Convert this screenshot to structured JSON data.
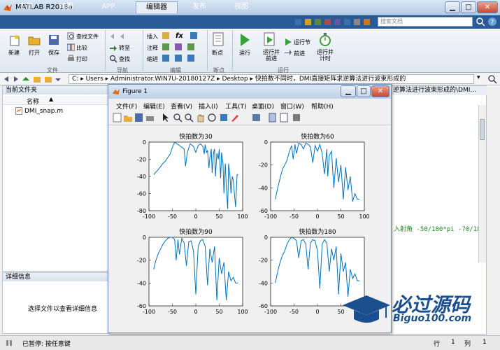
{
  "window": {
    "title": "MATLAB R2018a"
  },
  "tabs": [
    {
      "label": "主页"
    },
    {
      "label": "绘图"
    },
    {
      "label": "APP"
    },
    {
      "label": "编辑器"
    },
    {
      "label": "发布"
    },
    {
      "label": "视图"
    }
  ],
  "search": {
    "placeholder": "搜索文档"
  },
  "ribbon": {
    "file": {
      "new": "新建",
      "open": "打开",
      "save": "保存",
      "find_files": "查找文件",
      "compare": "比较",
      "print": "打印",
      "group": "文件"
    },
    "nav": {
      "goto": "转至",
      "find": "查找",
      "group": "导航"
    },
    "edit": {
      "insert": "插入",
      "comment": "注释",
      "indent": "缩进",
      "fx": "fx",
      "group": "编辑"
    },
    "breakpoints": {
      "breakpoint": "断点",
      "group": "断点"
    },
    "run": {
      "run": "运行",
      "run_advance": "运行并前进",
      "run_section": "运行节",
      "advance": "前进",
      "run_time": "运行并计时",
      "group": "运行"
    }
  },
  "address": {
    "segments": [
      "C:",
      "Users",
      "Administrator.WIN7U-20180127Z",
      "Desktop",
      "快拍数不同时，DMI直接矩阵求逆算法进行波束形成的"
    ]
  },
  "current_folder": {
    "title": "当前文件夹",
    "column": "名称",
    "files": [
      "DMI_snap.m"
    ]
  },
  "details": {
    "title": "详细信息",
    "hint": "选择文件以查看详细信息"
  },
  "editor_tail": {
    "path_text": "逆算法进行波束形成的\\DMI...",
    "code_line": "入射角 -50/180*pi -70/180*"
  },
  "status": {
    "paused": "已暂停: 按任意键",
    "row_label": "行",
    "row_value": "1",
    "col_label": "列",
    "col_value": "1"
  },
  "figure": {
    "title": "Figure 1",
    "menu": [
      "文件(F)",
      "编辑(E)",
      "查看(V)",
      "插入(I)",
      "工具(T)",
      "桌面(D)",
      "窗口(W)",
      "帮助(H)"
    ]
  },
  "chart_data": [
    {
      "type": "line",
      "title": "快拍数为30",
      "xlim": [
        -100,
        100
      ],
      "ylim": [
        -80,
        0
      ],
      "xticks": [
        -100,
        -50,
        0,
        50,
        100
      ],
      "yticks": [
        0,
        -20,
        -40,
        -60,
        -80
      ],
      "x": [
        -90,
        -80,
        -72,
        -65,
        -60,
        -55,
        -50,
        -45,
        -40,
        -35,
        -30,
        -25,
        -22,
        -18,
        -12,
        -5,
        0,
        5,
        10,
        15,
        18,
        20,
        23,
        25,
        28,
        30,
        33,
        35,
        38,
        40,
        42,
        45,
        48,
        50,
        53,
        55,
        58,
        60,
        63,
        65,
        68,
        70,
        73,
        75,
        78,
        80,
        85,
        88,
        90
      ],
      "y": [
        -38,
        -32,
        -26,
        -22,
        -18,
        -14,
        -6,
        0,
        -2,
        -4,
        -6,
        -8,
        -28,
        -12,
        -2,
        -5,
        -12,
        -4,
        -2,
        -5,
        -14,
        -3,
        -12,
        -10,
        -30,
        -18,
        -8,
        -36,
        -12,
        -8,
        -40,
        -13,
        -20,
        -8,
        -42,
        -12,
        -25,
        -60,
        -25,
        -52,
        -78,
        -25,
        -40,
        -60,
        -40,
        -45,
        -76,
        -38,
        -38
      ]
    },
    {
      "type": "line",
      "title": "快拍数为60",
      "xlim": [
        -100,
        100
      ],
      "ylim": [
        -60,
        0
      ],
      "xticks": [
        -100,
        -50,
        0,
        50,
        100
      ],
      "yticks": [
        0,
        -20,
        -40,
        -60
      ],
      "x": [
        -90,
        -85,
        -80,
        -75,
        -70,
        -65,
        -60,
        -55,
        -52,
        -48,
        -45,
        -40,
        -35,
        -30,
        -25,
        -20,
        -15,
        -10,
        -5,
        0,
        5,
        10,
        15,
        20,
        22,
        25,
        30,
        35,
        40,
        45,
        50,
        55,
        60,
        65,
        70,
        75,
        80,
        85,
        90
      ],
      "y": [
        -50,
        -40,
        -32,
        -24,
        -20,
        -16,
        -8,
        -3,
        -15,
        -2,
        -10,
        -1,
        -2,
        -6,
        -1,
        -2,
        -4,
        -18,
        -3,
        -8,
        -2,
        -10,
        -28,
        -6,
        -30,
        -12,
        -8,
        -40,
        -14,
        -35,
        -20,
        -50,
        -22,
        -42,
        -30,
        -52,
        -45,
        -50,
        -50
      ]
    },
    {
      "type": "line",
      "title": "快拍数为90",
      "xlim": [
        -100,
        100
      ],
      "ylim": [
        -60,
        0
      ],
      "xticks": [
        -100,
        -50,
        0,
        50,
        100
      ],
      "yticks": [
        0,
        -20,
        -40,
        -60
      ],
      "x": [
        -90,
        -85,
        -80,
        -75,
        -70,
        -65,
        -60,
        -55,
        -50,
        -45,
        -42,
        -38,
        -35,
        -30,
        -25,
        -20,
        -15,
        -10,
        -5,
        0,
        5,
        10,
        15,
        20,
        25,
        30,
        35,
        40,
        45,
        50,
        55,
        60,
        65,
        70,
        75,
        80,
        85,
        90
      ],
      "y": [
        -28,
        -20,
        -14,
        -10,
        -6,
        -3,
        -1,
        0,
        0,
        -2,
        -20,
        -2,
        -15,
        -1,
        -5,
        -25,
        -4,
        -3,
        -12,
        -50,
        -8,
        -3,
        -2,
        -8,
        -42,
        -10,
        -22,
        -8,
        -55,
        -18,
        -32,
        -22,
        -55,
        -30,
        -38,
        -35,
        -40,
        -40
      ]
    },
    {
      "type": "line",
      "title": "快拍数为180",
      "xlim": [
        -100,
        100
      ],
      "ylim": [
        -60,
        0
      ],
      "xticks": [
        -100,
        -50,
        0,
        50,
        100
      ],
      "yticks": [
        0,
        -20,
        -40,
        -60
      ],
      "x": [
        -90,
        -85,
        -80,
        -75,
        -70,
        -65,
        -60,
        -55,
        -50,
        -45,
        -40,
        -35,
        -30,
        -25,
        -20,
        -15,
        -10,
        -5,
        0,
        5,
        10,
        15,
        20,
        25,
        30,
        35,
        40,
        45,
        50,
        55,
        60,
        65,
        70,
        75,
        80,
        85,
        90
      ],
      "y": [
        -40,
        -30,
        -22,
        -16,
        -12,
        -6,
        -2,
        0,
        -1,
        -3,
        -18,
        -3,
        -2,
        -6,
        -28,
        -5,
        -2,
        -3,
        -12,
        -45,
        -6,
        -2,
        -5,
        -30,
        -10,
        -20,
        -8,
        -50,
        -14,
        -30,
        -22,
        -52,
        -28,
        -36,
        -32,
        -38,
        -38
      ]
    }
  ]
}
